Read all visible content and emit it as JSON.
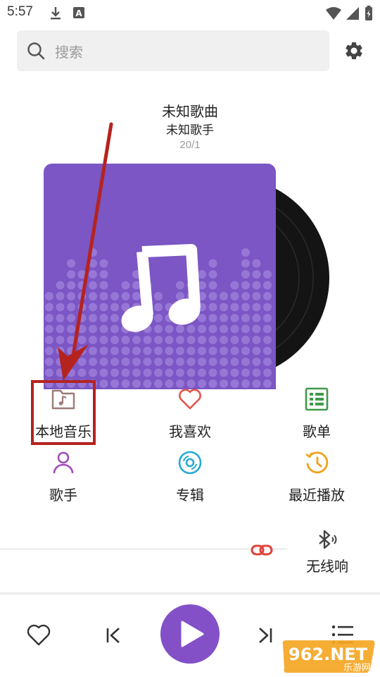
{
  "status_bar": {
    "time": "5:57"
  },
  "search": {
    "placeholder": "搜索"
  },
  "now_playing": {
    "title": "未知歌曲",
    "artist": "未知歌手",
    "date": "20/1"
  },
  "grid": [
    {
      "label": "本地音乐",
      "icon": "folder-music-icon",
      "color": "#9b7b78"
    },
    {
      "label": "我喜欢",
      "icon": "heart-icon",
      "color": "#e2554d"
    },
    {
      "label": "歌单",
      "icon": "playlist-icon",
      "color": "#3f9a4a"
    },
    {
      "label": "歌手",
      "icon": "singer-icon",
      "color": "#a14bbd"
    },
    {
      "label": "专辑",
      "icon": "album-icon",
      "color": "#25a9d8"
    },
    {
      "label": "最近播放",
      "icon": "history-icon",
      "color": "#f0a21b"
    }
  ],
  "wireless": {
    "label": "无线响"
  },
  "watermark": {
    "brand": "962.NET",
    "sub": "乐游网"
  },
  "colors": {
    "accent": "#8350c8",
    "album_bg": "#7b56c4",
    "annotation_red": "#b5231f"
  }
}
